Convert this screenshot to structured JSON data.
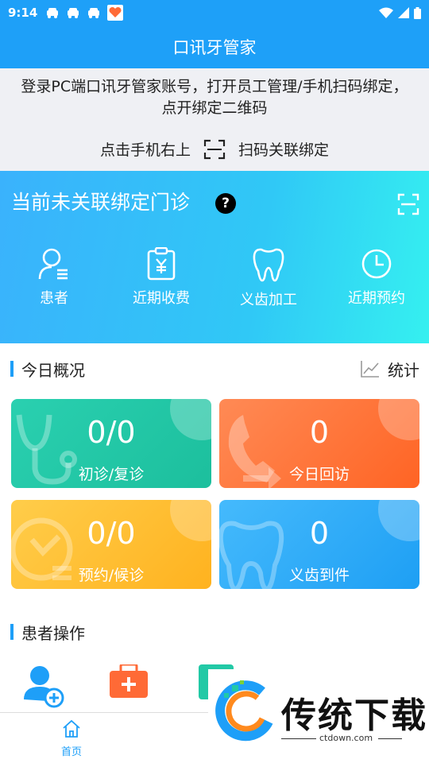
{
  "status_bar": {
    "time": "9:14"
  },
  "app_title": "口讯牙管家",
  "notice": {
    "message": "登录PC端口讯牙管家账号，打开员工管理/手机扫码绑定，点开绑定二维码",
    "hint_left": "点击手机右上",
    "hint_right": "扫码关联绑定"
  },
  "hero": {
    "title": "当前未关联绑定门诊",
    "help": "?",
    "menus": [
      {
        "label": "患者",
        "icon": "patient-icon"
      },
      {
        "label": "近期收费",
        "icon": "clipboard-yen-icon"
      },
      {
        "label": "义齿加工",
        "icon": "tooth-icon"
      },
      {
        "label": "近期预约",
        "icon": "clock-icon"
      }
    ]
  },
  "today": {
    "title": "今日概况",
    "stats_label": "统计",
    "cards": [
      {
        "value": "0/0",
        "label": "初诊/复诊",
        "color": "#22c9a6"
      },
      {
        "value": "0",
        "label": "今日回访",
        "color": "#ff6a36"
      },
      {
        "value": "0/0",
        "label": "预约/候诊",
        "color": "#ffbe2e"
      },
      {
        "value": "0",
        "label": "义齿到件",
        "color": "#29a8f6"
      }
    ]
  },
  "patient_ops": {
    "title": "患者操作"
  },
  "tabbar": {
    "home": "首页"
  },
  "watermark": {
    "text": "传统下载",
    "url": "ctdown.com"
  },
  "colors": {
    "primary": "#1ea0f8"
  }
}
